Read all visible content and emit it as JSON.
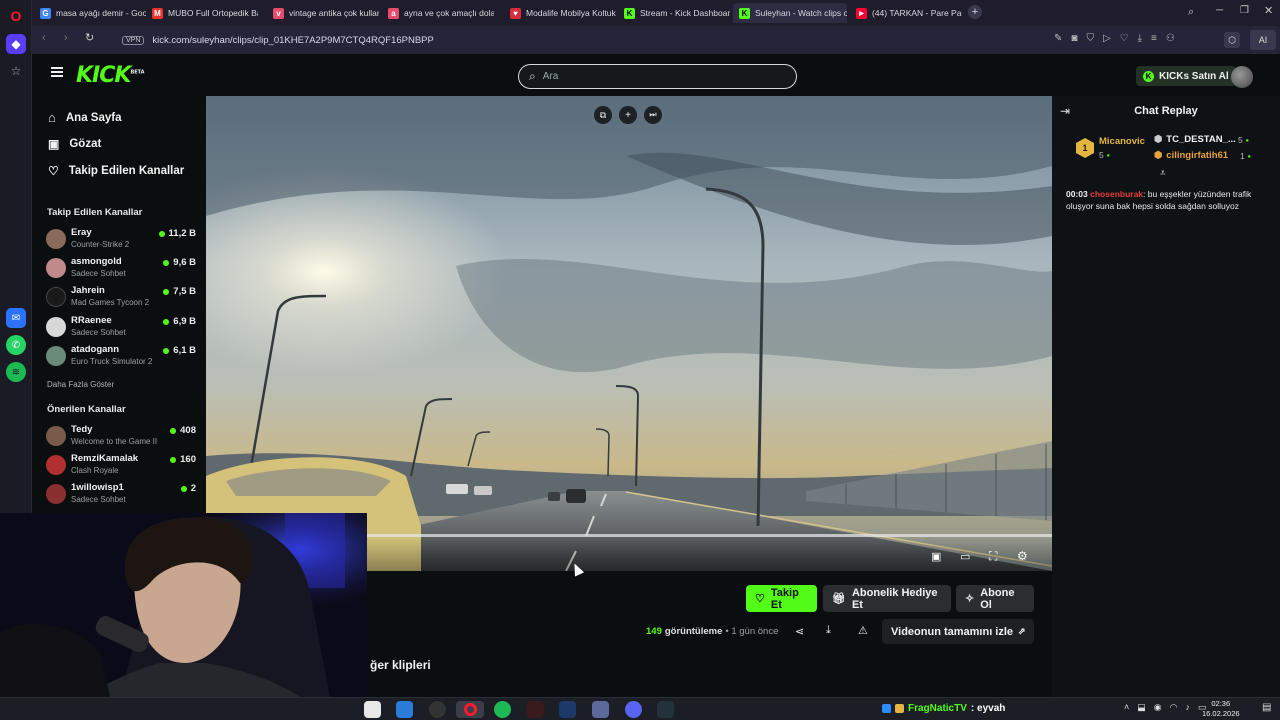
{
  "browser": {
    "tabs": [
      {
        "label": "masa ayağı demir - Googl",
        "fav_color": "#4285f4",
        "fav_glyph": "G"
      },
      {
        "label": "MUBO Full Ortopedik Baz",
        "fav_color": "#e7352b",
        "fav_glyph": "M"
      },
      {
        "label": "vintage antika çok kullanı",
        "fav_color": "#e74c6c",
        "fav_glyph": "v"
      },
      {
        "label": "ayna ve çok amaçlı dolap",
        "fav_color": "#e74c6c",
        "fav_glyph": "a"
      },
      {
        "label": "Modalife Mobilya Koltuk,",
        "fav_color": "#d62d3a",
        "fav_glyph": "♥"
      },
      {
        "label": "Stream - Kick Dashboard",
        "fav_color": "#53fc18",
        "fav_glyph": "K"
      },
      {
        "label": "Suleyhan - Watch clips on",
        "fav_color": "#53fc18",
        "fav_glyph": "K"
      },
      {
        "label": "(44) TARKAN - Pare Pare (",
        "fav_color": "#ff0033",
        "fav_glyph": "▶"
      }
    ],
    "vpn_label": "VPN",
    "url": "kick.com/suleyhan/clips/clip_01KHE7A2P9M7CTQ4RQF16PNBPP",
    "ai_label": "AI"
  },
  "header": {
    "logo": "KICK",
    "logo_beta": "BETA",
    "search_placeholder": "Ara",
    "kicks_button": "KICKs Satın Al",
    "accent": "#53fc18"
  },
  "sidebar": {
    "nav": [
      {
        "label": "Ana Sayfa",
        "icon": "home-icon"
      },
      {
        "label": "Gözat",
        "icon": "browse-icon"
      },
      {
        "label": "Takip Edilen Kanallar",
        "icon": "heart-icon"
      }
    ],
    "followed_heading": "Takip Edilen Kanallar",
    "followed": [
      {
        "name": "Eray",
        "game": "Counter-Strike 2",
        "viewers": "11,2 B",
        "color": "#8a6a5a"
      },
      {
        "name": "asmongold",
        "game": "Sadece Sohbet",
        "viewers": "9,6 B",
        "color": "#c08a8a"
      },
      {
        "name": "Jahrein",
        "game": "Mad Games Tycoon 2",
        "viewers": "7,5 B",
        "color": "#1a1a1a"
      },
      {
        "name": "RRaenee",
        "game": "Sadece Sohbet",
        "viewers": "6,9 B",
        "color": "#d8d8d8"
      },
      {
        "name": "atadogann",
        "game": "Euro Truck Simulator 2",
        "viewers": "6,1 B",
        "color": "#6a8a7a"
      }
    ],
    "show_more": "Daha Fazla Göster",
    "recommended_heading": "Önerilen Kanallar",
    "recommended": [
      {
        "name": "Tedy",
        "game": "Welcome to the Game II",
        "viewers": "408",
        "color": "#7a5a4a"
      },
      {
        "name": "RemziKamalak",
        "game": "Clash Royale",
        "viewers": "160",
        "color": "#b03030"
      },
      {
        "name": "1willowisp1",
        "game": "Sadece Sohbet",
        "viewers": "2",
        "color": "#8a3030"
      }
    ]
  },
  "video": {
    "progress": 0.03
  },
  "actions": {
    "follow": "Takip Et",
    "gift_sub": "Abonelik Hediye Et",
    "subscribe": "Abone Ol",
    "views_count": "149",
    "views_label": "görüntüleme",
    "time_ago": "• 1 gün önce",
    "watch_full": "Videonun tamamını izle",
    "other_clips": "ğer klipleri"
  },
  "chat": {
    "title": "Chat Replay",
    "leaders": [
      {
        "rank": "1",
        "name": "Micanovic",
        "count": "5"
      },
      {
        "name": "TC_DESTAN_...",
        "count": "5"
      },
      {
        "name": "cilingirfatih61",
        "count": "1"
      }
    ],
    "messages": [
      {
        "time": "00:03",
        "user": "chosenburak",
        "text": ": bu eşşekler yüzünden trafik oluşyor suna bak hepsi solda sağdan solluyoz"
      }
    ]
  },
  "taskbar": {
    "chat_user": "FragNaticTV",
    "chat_text": ": eyvah",
    "time": "02:36",
    "date": "16.02.2026"
  }
}
